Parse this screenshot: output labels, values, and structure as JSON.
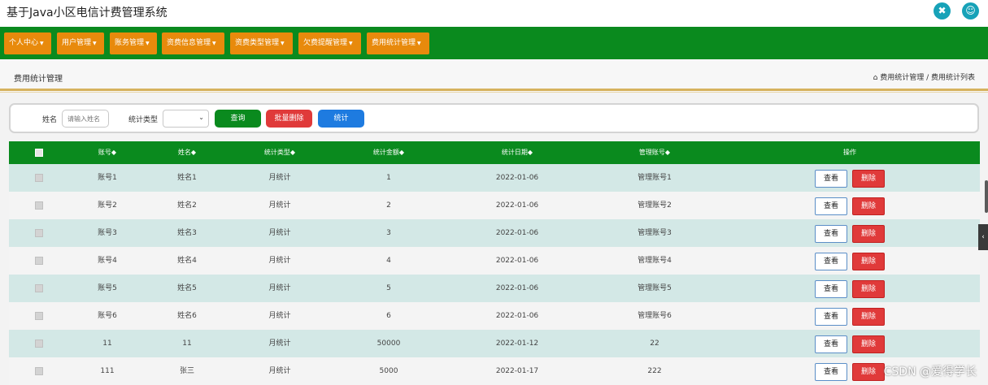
{
  "app": {
    "title": "基于Java小区电信计费管理系统"
  },
  "top_icons": [
    "network-icon",
    "user-icon"
  ],
  "nav": {
    "items": [
      {
        "label": "个人中心"
      },
      {
        "label": "用户管理"
      },
      {
        "label": "账务管理"
      },
      {
        "label": "资费信息管理"
      },
      {
        "label": "资费类型管理"
      },
      {
        "label": "欠费提醒管理"
      },
      {
        "label": "费用统计管理"
      }
    ]
  },
  "section": {
    "title": "费用统计管理",
    "breadcrumb": "费用统计管理 / 费用统计列表"
  },
  "search": {
    "name_label": "姓名",
    "name_placeholder": "请输入姓名",
    "type_label": "统计类型",
    "type_value": "",
    "query_label": "查询",
    "batch_delete_label": "批量删除",
    "stats_label": "统计"
  },
  "table": {
    "headers": {
      "account": "账号◆",
      "name": "姓名◆",
      "type": "统计类型◆",
      "amount": "统计金额◆",
      "date": "统计日期◆",
      "manager": "管理账号◆",
      "actions": "操作"
    },
    "view_label": "查看",
    "delete_label": "删除",
    "rows": [
      {
        "account": "账号1",
        "name": "姓名1",
        "type": "月统计",
        "amount": "1",
        "date": "2022-01-06",
        "manager": "管理账号1"
      },
      {
        "account": "账号2",
        "name": "姓名2",
        "type": "月统计",
        "amount": "2",
        "date": "2022-01-06",
        "manager": "管理账号2"
      },
      {
        "account": "账号3",
        "name": "姓名3",
        "type": "月统计",
        "amount": "3",
        "date": "2022-01-06",
        "manager": "管理账号3"
      },
      {
        "account": "账号4",
        "name": "姓名4",
        "type": "月统计",
        "amount": "4",
        "date": "2022-01-06",
        "manager": "管理账号4"
      },
      {
        "account": "账号5",
        "name": "姓名5",
        "type": "月统计",
        "amount": "5",
        "date": "2022-01-06",
        "manager": "管理账号5"
      },
      {
        "account": "账号6",
        "name": "姓名6",
        "type": "月统计",
        "amount": "6",
        "date": "2022-01-06",
        "manager": "管理账号6"
      },
      {
        "account": "11",
        "name": "11",
        "type": "月统计",
        "amount": "50000",
        "date": "2022-01-12",
        "manager": "22"
      },
      {
        "account": "111",
        "name": "张三",
        "type": "月统计",
        "amount": "5000",
        "date": "2022-01-17",
        "manager": "222"
      }
    ]
  },
  "watermark": "CSDN @爱得学长",
  "colors": {
    "nav_green": "#0a8a1e",
    "nav_orange": "#e88a0c",
    "query_green": "#0a8a1e",
    "delete_red": "#e03a3a",
    "stats_blue": "#1e7be0",
    "row_teal": "#d3e8e6"
  }
}
